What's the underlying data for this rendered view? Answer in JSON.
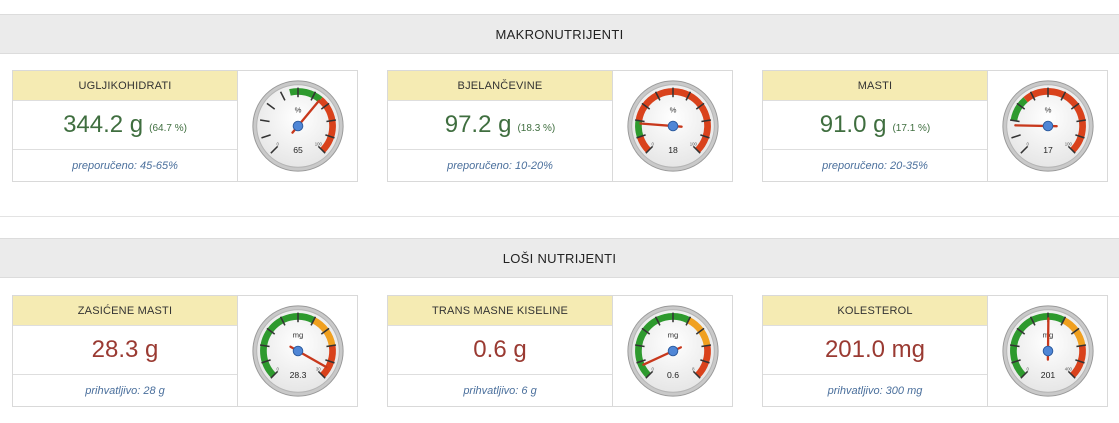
{
  "sections": {
    "macro": {
      "title": "MAKRONUTRIJENTI"
    },
    "bad": {
      "title": "LOŠI NUTRIJENTI"
    }
  },
  "cards": [
    {
      "title": "UGLJIKOHIDRATI",
      "value": "344.2 g",
      "percent": "(64.7 %)",
      "note": "preporučeno: 45-65%",
      "gauge": {
        "unit": "%",
        "readout": "65",
        "min_label": "0",
        "max_label": "100",
        "needle_fraction": 0.647,
        "zones": [
          {
            "from": 0.45,
            "to": 0.65,
            "color": "#2e9a2e"
          },
          {
            "from": 0.65,
            "to": 1.0,
            "color": "#d9421c"
          }
        ]
      }
    },
    {
      "title": "BJELANČEVINE",
      "value": "97.2 g",
      "percent": "(18.3 %)",
      "note": "preporučeno: 10-20%",
      "gauge": {
        "unit": "%",
        "readout": "18",
        "min_label": "0",
        "max_label": "100",
        "needle_fraction": 0.183,
        "zones": [
          {
            "from": 0.0,
            "to": 0.1,
            "color": "#d9421c"
          },
          {
            "from": 0.1,
            "to": 0.2,
            "color": "#2e9a2e"
          },
          {
            "from": 0.2,
            "to": 1.0,
            "color": "#d9421c"
          }
        ]
      }
    },
    {
      "title": "MASTI",
      "value": "91.0 g",
      "percent": "(17.1 %)",
      "note": "preporučeno: 20-35%",
      "gauge": {
        "unit": "%",
        "readout": "17",
        "min_label": "0",
        "max_label": "100",
        "needle_fraction": 0.171,
        "zones": [
          {
            "from": 0.2,
            "to": 0.35,
            "color": "#2e9a2e"
          },
          {
            "from": 0.35,
            "to": 1.0,
            "color": "#d9421c"
          }
        ]
      }
    },
    {
      "title": "ZASIĆENE MASTI",
      "value": "28.3 g",
      "percent": "",
      "note": "prihvatljivo: 28 g",
      "gauge": {
        "unit": "mg",
        "readout": "28.3",
        "min_label": "0",
        "max_label": "30",
        "needle_fraction": 0.943,
        "zones": [
          {
            "from": 0.0,
            "to": 0.6,
            "color": "#2e9a2e"
          },
          {
            "from": 0.6,
            "to": 0.8,
            "color": "#f0a020"
          },
          {
            "from": 0.8,
            "to": 1.0,
            "color": "#d9421c"
          }
        ]
      }
    },
    {
      "title": "TRANS MASNE KISELINE",
      "value": "0.6 g",
      "percent": "",
      "note": "prihvatljivo: 6 g",
      "gauge": {
        "unit": "mg",
        "readout": "0.6",
        "min_label": "0",
        "max_label": "8",
        "needle_fraction": 0.075,
        "zones": [
          {
            "from": 0.0,
            "to": 0.6,
            "color": "#2e9a2e"
          },
          {
            "from": 0.6,
            "to": 0.8,
            "color": "#f0a020"
          },
          {
            "from": 0.8,
            "to": 1.0,
            "color": "#d9421c"
          }
        ]
      }
    },
    {
      "title": "KOLESTEROL",
      "value": "201.0 mg",
      "percent": "",
      "note": "prihvatljivo: 300 mg",
      "gauge": {
        "unit": "mg",
        "readout": "201",
        "min_label": "0",
        "max_label": "400",
        "needle_fraction": 0.5025,
        "zones": [
          {
            "from": 0.0,
            "to": 0.6,
            "color": "#2e9a2e"
          },
          {
            "from": 0.6,
            "to": 0.8,
            "color": "#f0a020"
          },
          {
            "from": 0.8,
            "to": 1.0,
            "color": "#d9421c"
          }
        ]
      }
    }
  ]
}
